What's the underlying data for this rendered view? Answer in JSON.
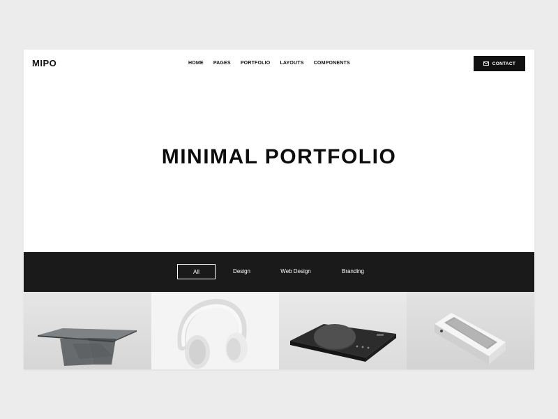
{
  "header": {
    "logo": "MIPO",
    "nav": [
      "HOME",
      "PAGES",
      "PORTFOLIO",
      "LAYOUTS",
      "COMPONENTS"
    ],
    "contact_label": "CONTACT",
    "contact_icon": "envelope-icon"
  },
  "hero": {
    "title": "MINIMAL PORTFOLIO"
  },
  "filters": {
    "items": [
      "All",
      "Design",
      "Web Design",
      "Branding"
    ],
    "active": "All"
  },
  "portfolio": {
    "items": [
      {
        "subject": "glass-table-image"
      },
      {
        "subject": "headphones-image"
      },
      {
        "subject": "kitchen-scale-image"
      },
      {
        "subject": "speaker-device-image"
      }
    ]
  },
  "colors": {
    "background": "#ececec",
    "page": "#ffffff",
    "dark": "#1a1a1a",
    "text": "#111111"
  }
}
